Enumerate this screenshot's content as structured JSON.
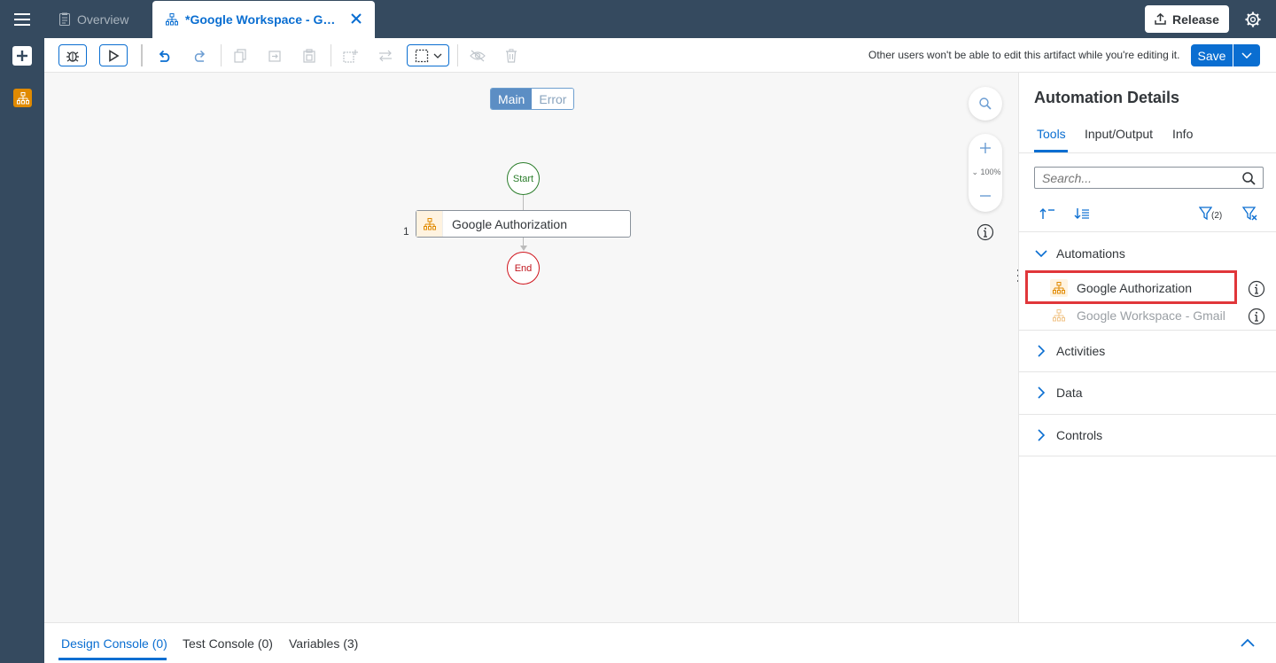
{
  "topbar": {
    "menu_icon": "hamburger-menu-icon",
    "tabs": [
      {
        "label": "Overview",
        "icon": "clipboard-icon"
      },
      {
        "label": "*Google Workspace - Gm...",
        "icon": "automation-icon"
      }
    ],
    "release_label": "Release",
    "settings_icon": "gear-icon"
  },
  "toolbar": {
    "edit_message": "Other users won't be able to edit this artifact while you're editing it.",
    "save_label": "Save"
  },
  "canvas": {
    "flows": [
      "Main",
      "Error"
    ],
    "active_flow": "Main",
    "start_label": "Start",
    "end_label": "End",
    "step": {
      "number": "1",
      "label": "Google Authorization"
    },
    "zoom_level": "100%"
  },
  "panel": {
    "title": "Automation Details",
    "tabs": [
      "Tools",
      "Input/Output",
      "Info"
    ],
    "active_tab": "Tools",
    "search_placeholder": "Search...",
    "filter_count": "(2)",
    "sections": [
      {
        "label": "Automations",
        "expanded": true,
        "items": [
          {
            "label": "Google Authorization",
            "enabled": true
          },
          {
            "label": "Google Workspace - Gmail",
            "enabled": false
          }
        ]
      },
      {
        "label": "Activities",
        "expanded": false
      },
      {
        "label": "Data",
        "expanded": false
      },
      {
        "label": "Controls",
        "expanded": false
      }
    ]
  },
  "console": {
    "tabs": [
      "Design Console (0)",
      "Test Console (0)",
      "Variables (3)"
    ],
    "active_tab": "Design Console (0)"
  },
  "colors": {
    "shell": "#354a5f",
    "accent": "#0a6ed1",
    "automation_orange": "#e08a00",
    "highlight_red": "#e0363a"
  }
}
